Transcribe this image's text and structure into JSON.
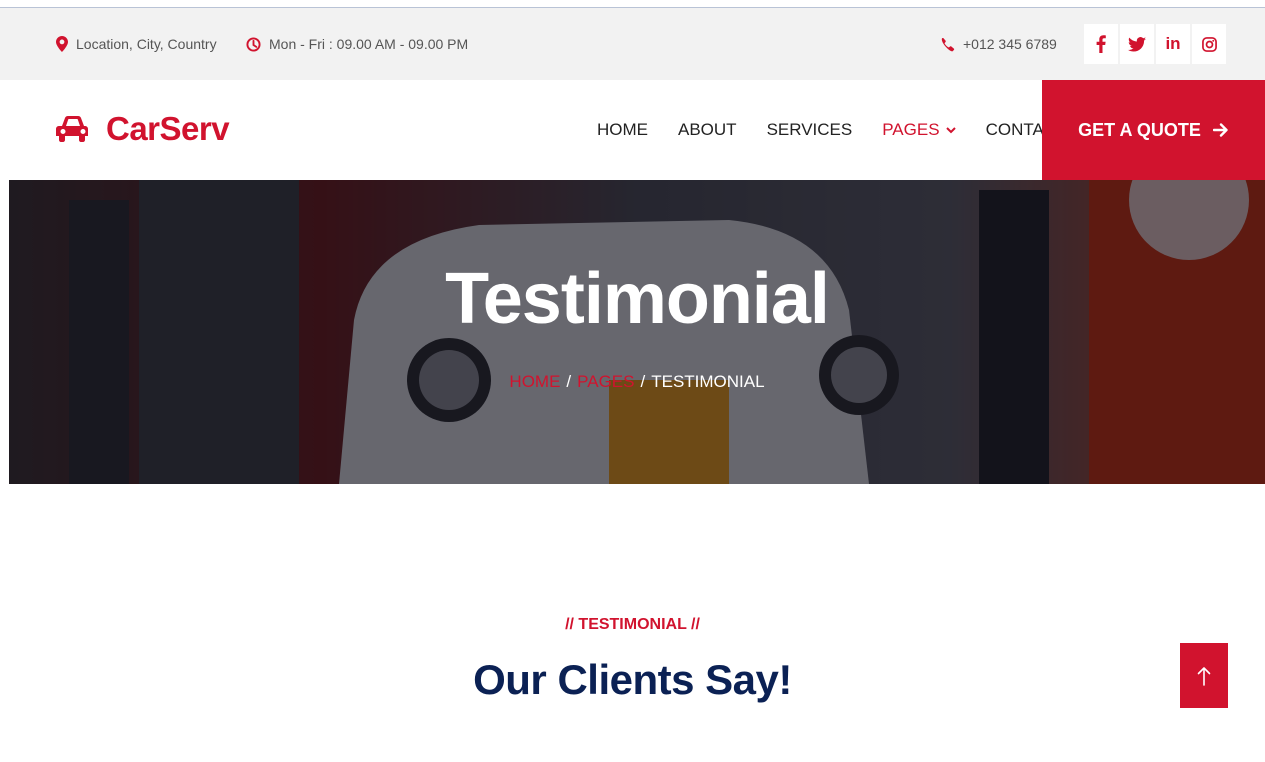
{
  "topbar": {
    "location": "Location, City, Country",
    "hours": "Mon - Fri : 09.00 AM - 09.00 PM",
    "phone": "+012 345 6789",
    "social": [
      {
        "icon": "facebook-icon",
        "glyph": "f"
      },
      {
        "icon": "twitter-icon",
        "glyph": "t"
      },
      {
        "icon": "linkedin-icon",
        "glyph": "in"
      },
      {
        "icon": "instagram-icon",
        "glyph": "ig"
      }
    ]
  },
  "navbar": {
    "brand": "CarServ",
    "items": [
      {
        "label": "HOME",
        "active": false
      },
      {
        "label": "ABOUT",
        "active": false
      },
      {
        "label": "SERVICES",
        "active": false
      },
      {
        "label": "PAGES",
        "active": true,
        "dropdown": true
      },
      {
        "label": "CONTACT",
        "active": false
      }
    ],
    "cta": "GET A QUOTE"
  },
  "hero": {
    "title": "Testimonial",
    "breadcrumb": [
      "HOME",
      "PAGES",
      "TESTIMONIAL"
    ]
  },
  "section": {
    "eyebrow": "// TESTIMONIAL //",
    "title": "Our Clients Say!"
  },
  "colors": {
    "accent": "#d1132e",
    "navy": "#0b2154",
    "topbar_bg": "#f2f2f2"
  }
}
